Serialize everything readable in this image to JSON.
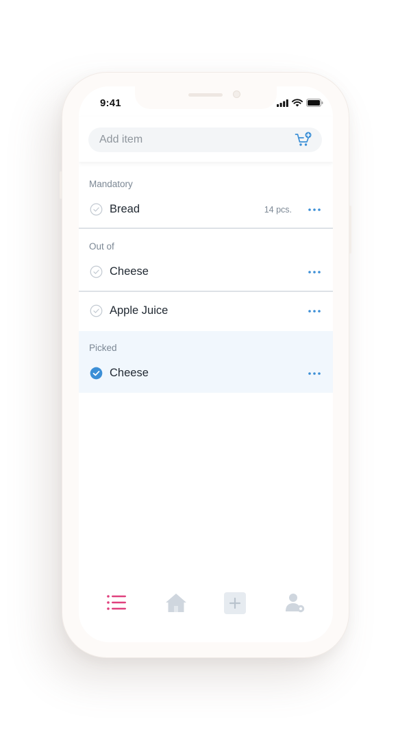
{
  "status_bar": {
    "time": "9:41"
  },
  "search": {
    "placeholder": "Add item",
    "value": ""
  },
  "icons": {
    "cart": "cart-add-icon",
    "check_empty": "check-circle-outline-icon",
    "check_done": "check-circle-filled-icon",
    "more": "more-horizontal-icon",
    "tab_list": "list-icon",
    "tab_home": "home-icon",
    "tab_add": "plus-square-icon",
    "tab_profile": "user-settings-icon"
  },
  "colors": {
    "accent": "#3c8fd6",
    "tab_active": "#e0417e",
    "tab_inactive": "#cfd6de",
    "picked_background": "#f1f7fd"
  },
  "sections": [
    {
      "label": "Mandatory",
      "items": [
        {
          "name": "Bread",
          "quantity": "14 pcs.",
          "checked": false
        }
      ]
    },
    {
      "label": "Out of",
      "items": [
        {
          "name": "Cheese",
          "quantity": "",
          "checked": false
        },
        {
          "name": "Apple Juice",
          "quantity": "",
          "checked": false
        }
      ]
    },
    {
      "label": "Picked",
      "items": [
        {
          "name": "Cheese",
          "quantity": "",
          "checked": true
        }
      ]
    }
  ]
}
